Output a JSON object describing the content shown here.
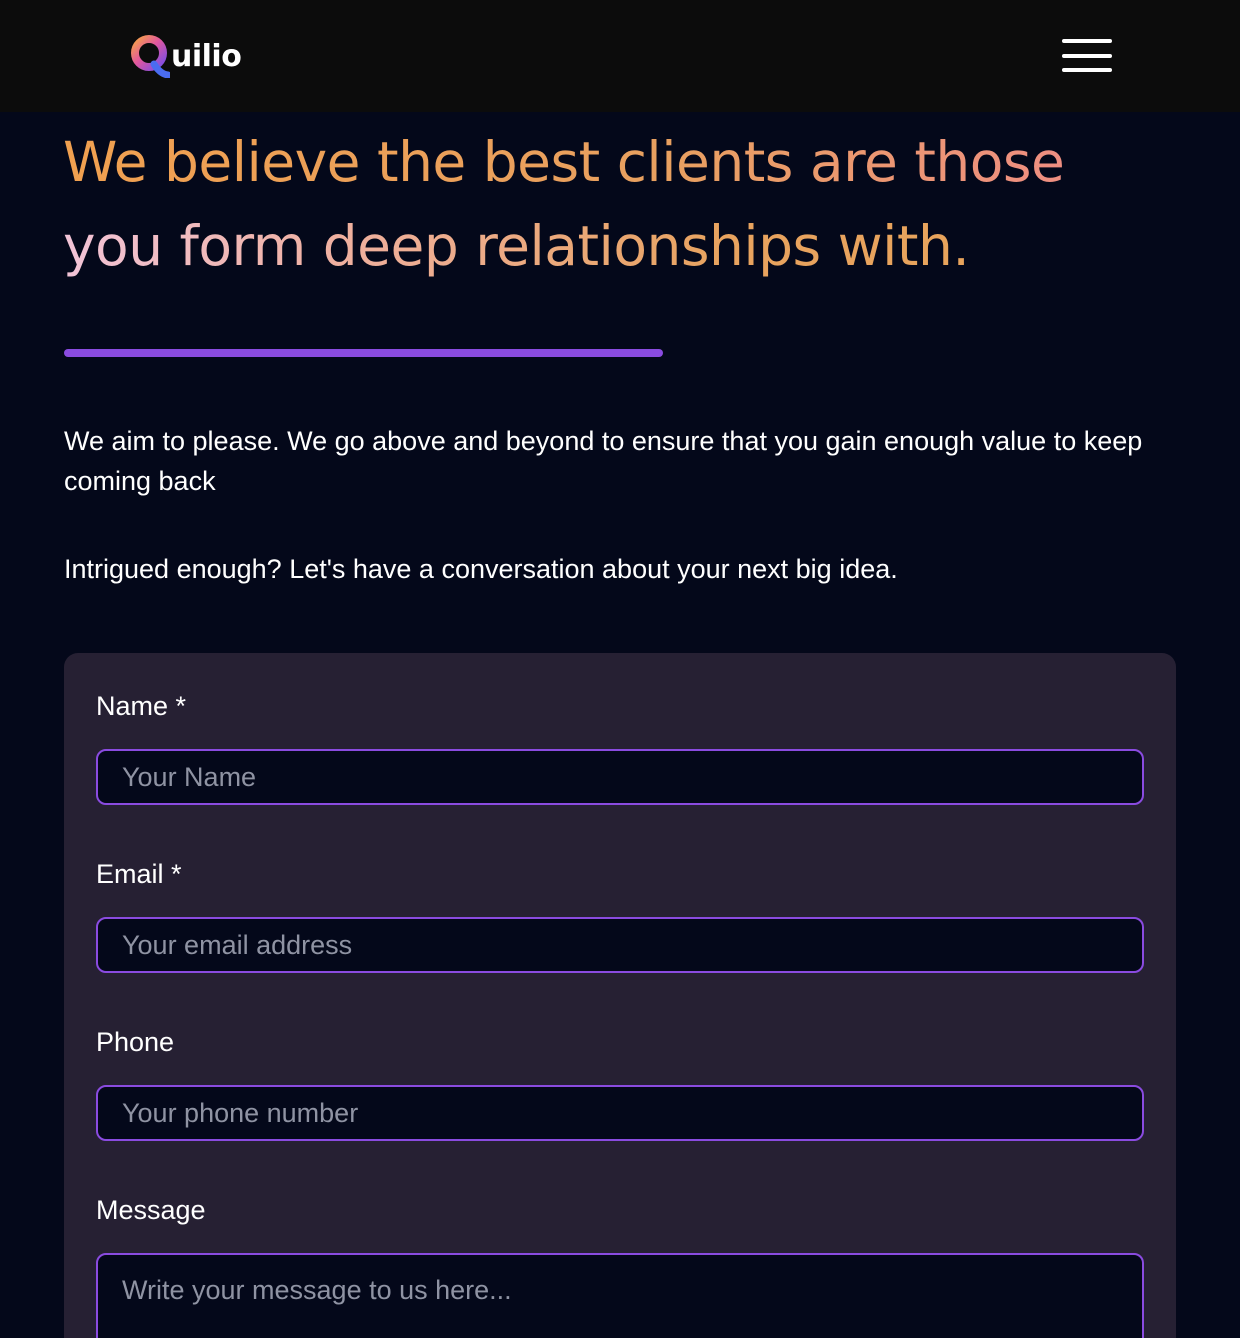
{
  "header": {
    "logo_text": "uilio",
    "logo_letter": "Q",
    "menu_icon": "hamburger-menu-icon"
  },
  "hero": {
    "headline_line1": "We believe the best clients are those",
    "headline_line2": "you form deep relationships with.",
    "paragraph1": "We aim to please. We go above and beyond to ensure that you gain enough value to keep coming back",
    "paragraph2": "Intrigued enough? Let's have a conversation about your next big idea."
  },
  "form": {
    "name_label": "Name *",
    "name_placeholder": "Your Name",
    "email_label": "Email *",
    "email_placeholder": "Your email address",
    "phone_label": "Phone",
    "phone_placeholder": "Your phone number",
    "message_label": "Message",
    "message_placeholder": "Write your message to us here..."
  },
  "colors": {
    "background": "#04081a",
    "header_background": "#0c0c0c",
    "card_background": "#262033",
    "accent_purple": "#8a4be0",
    "headline_orange": "#e8a05c",
    "headline_pink": "#f08a8a",
    "placeholder_gray": "#8f93a3"
  }
}
